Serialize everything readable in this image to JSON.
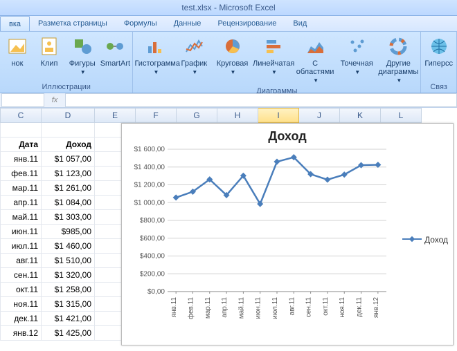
{
  "title": "test.xlsx - Microsoft Excel",
  "tabs": {
    "active": "вка",
    "items": [
      "вка",
      "Разметка страницы",
      "Формулы",
      "Данные",
      "Рецензирование",
      "Вид"
    ]
  },
  "ribbon": {
    "groups": [
      {
        "label": "Иллюстрации",
        "buttons": [
          {
            "name": "picture",
            "label": "нок",
            "color": "#f6c050"
          },
          {
            "name": "clip",
            "label": "Клип",
            "color": "#f6c050"
          },
          {
            "name": "shapes",
            "label": "Фигуры",
            "dd": true,
            "color": "#5e9cd3"
          },
          {
            "name": "smartart",
            "label": "SmartArt",
            "color": "#6aa84f"
          }
        ]
      },
      {
        "label": "Диаграммы",
        "buttons": [
          {
            "name": "column",
            "label": "Гистограмма",
            "dd": true
          },
          {
            "name": "line",
            "label": "График",
            "dd": true
          },
          {
            "name": "pie",
            "label": "Круговая",
            "dd": true
          },
          {
            "name": "bar",
            "label": "Линейчатая",
            "dd": true
          },
          {
            "name": "area",
            "label": "С\nобластями",
            "dd": true
          },
          {
            "name": "scatter",
            "label": "Точечная",
            "dd": true
          },
          {
            "name": "other",
            "label": "Другие\nдиаграммы",
            "dd": true
          }
        ]
      },
      {
        "label": "Связ",
        "buttons": [
          {
            "name": "hyperlink",
            "label": "Гиперсс"
          }
        ]
      }
    ]
  },
  "columns": [
    "C",
    "D",
    "E",
    "F",
    "G",
    "H",
    "I",
    "J",
    "K",
    "L"
  ],
  "selected_col": "I",
  "table": {
    "headers": {
      "c": "Дата",
      "d": "Доход"
    },
    "rows": [
      {
        "c": "янв.11",
        "d": "$1 057,00"
      },
      {
        "c": "фев.11",
        "d": "$1 123,00"
      },
      {
        "c": "мар.11",
        "d": "$1 261,00"
      },
      {
        "c": "апр.11",
        "d": "$1 084,00"
      },
      {
        "c": "май.11",
        "d": "$1 303,00"
      },
      {
        "c": "июн.11",
        "d": "$985,00"
      },
      {
        "c": "июл.11",
        "d": "$1 460,00"
      },
      {
        "c": "авг.11",
        "d": "$1 510,00"
      },
      {
        "c": "сен.11",
        "d": "$1 320,00"
      },
      {
        "c": "окт.11",
        "d": "$1 258,00"
      },
      {
        "c": "ноя.11",
        "d": "$1 315,00"
      },
      {
        "c": "дек.11",
        "d": "$1 421,00"
      },
      {
        "c": "янв.12",
        "d": "$1 425,00"
      }
    ]
  },
  "chart_data": {
    "type": "line",
    "title": "Доход",
    "legend": "Доход",
    "ylabel": "",
    "xlabel": "",
    "ylim": [
      0,
      1600
    ],
    "y_ticks": [
      "$0,00",
      "$200,00",
      "$400,00",
      "$600,00",
      "$800,00",
      "$1 000,00",
      "$1 200,00",
      "$1 400,00",
      "$1 600,00"
    ],
    "categories": [
      "янв.11",
      "фев.11",
      "мар.11",
      "апр.11",
      "май.11",
      "июн.11",
      "июл.11",
      "авг.11",
      "сен.11",
      "окт.11",
      "ноя.11",
      "дек.11",
      "янв.12"
    ],
    "values": [
      1057,
      1123,
      1261,
      1084,
      1303,
      985,
      1460,
      1510,
      1320,
      1258,
      1315,
      1421,
      1425
    ],
    "line_color": "#4a7ebb"
  }
}
